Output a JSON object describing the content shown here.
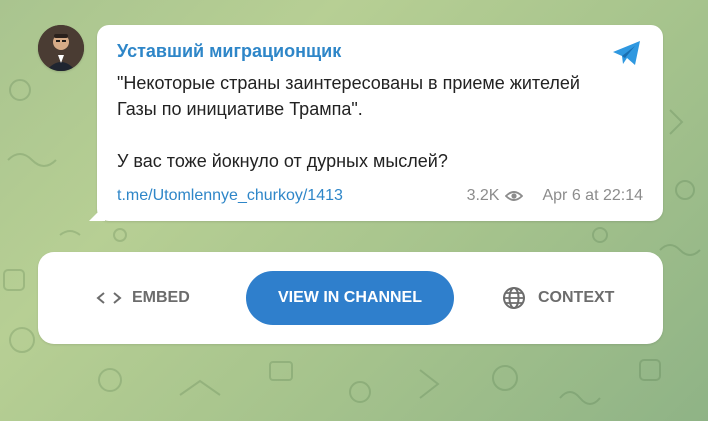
{
  "message": {
    "channel_name": "Уставший миграционщик",
    "text_lines": [
      "\"Некоторые страны заинтересованы в приеме жителей",
      "Газы по инициативе Трампа\".",
      "У вас тоже йокнуло от дурных мыслей?"
    ],
    "link": "t.me/Utomlennye_churkoy/1413",
    "views": "3.2K",
    "date": "Apr 6 at 22:14"
  },
  "actions": {
    "embed_label": "EMBED",
    "view_label": "VIEW IN CHANNEL",
    "context_label": "CONTEXT"
  },
  "icons": {
    "avatar": "channel-avatar",
    "telegram": "telegram-icon",
    "eye": "eye-icon",
    "embed": "code-brackets-icon",
    "globe": "globe-icon"
  },
  "colors": {
    "accent": "#2e86c8",
    "button": "#2f7fcc",
    "background": "#a9c48f",
    "meta": "#8c8c8c"
  }
}
